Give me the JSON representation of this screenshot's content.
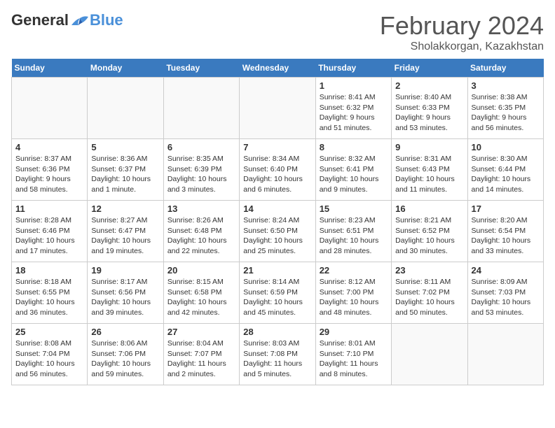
{
  "header": {
    "logo": {
      "general": "General",
      "blue": "Blue"
    },
    "title": "February 2024",
    "location": "Sholakkorgan, Kazakhstan"
  },
  "weekdays": [
    "Sunday",
    "Monday",
    "Tuesday",
    "Wednesday",
    "Thursday",
    "Friday",
    "Saturday"
  ],
  "weeks": [
    [
      {
        "day": "",
        "info": ""
      },
      {
        "day": "",
        "info": ""
      },
      {
        "day": "",
        "info": ""
      },
      {
        "day": "",
        "info": ""
      },
      {
        "day": "1",
        "info": "Sunrise: 8:41 AM\nSunset: 6:32 PM\nDaylight: 9 hours and 51 minutes."
      },
      {
        "day": "2",
        "info": "Sunrise: 8:40 AM\nSunset: 6:33 PM\nDaylight: 9 hours and 53 minutes."
      },
      {
        "day": "3",
        "info": "Sunrise: 8:38 AM\nSunset: 6:35 PM\nDaylight: 9 hours and 56 minutes."
      }
    ],
    [
      {
        "day": "4",
        "info": "Sunrise: 8:37 AM\nSunset: 6:36 PM\nDaylight: 9 hours and 58 minutes."
      },
      {
        "day": "5",
        "info": "Sunrise: 8:36 AM\nSunset: 6:37 PM\nDaylight: 10 hours and 1 minute."
      },
      {
        "day": "6",
        "info": "Sunrise: 8:35 AM\nSunset: 6:39 PM\nDaylight: 10 hours and 3 minutes."
      },
      {
        "day": "7",
        "info": "Sunrise: 8:34 AM\nSunset: 6:40 PM\nDaylight: 10 hours and 6 minutes."
      },
      {
        "day": "8",
        "info": "Sunrise: 8:32 AM\nSunset: 6:41 PM\nDaylight: 10 hours and 9 minutes."
      },
      {
        "day": "9",
        "info": "Sunrise: 8:31 AM\nSunset: 6:43 PM\nDaylight: 10 hours and 11 minutes."
      },
      {
        "day": "10",
        "info": "Sunrise: 8:30 AM\nSunset: 6:44 PM\nDaylight: 10 hours and 14 minutes."
      }
    ],
    [
      {
        "day": "11",
        "info": "Sunrise: 8:28 AM\nSunset: 6:46 PM\nDaylight: 10 hours and 17 minutes."
      },
      {
        "day": "12",
        "info": "Sunrise: 8:27 AM\nSunset: 6:47 PM\nDaylight: 10 hours and 19 minutes."
      },
      {
        "day": "13",
        "info": "Sunrise: 8:26 AM\nSunset: 6:48 PM\nDaylight: 10 hours and 22 minutes."
      },
      {
        "day": "14",
        "info": "Sunrise: 8:24 AM\nSunset: 6:50 PM\nDaylight: 10 hours and 25 minutes."
      },
      {
        "day": "15",
        "info": "Sunrise: 8:23 AM\nSunset: 6:51 PM\nDaylight: 10 hours and 28 minutes."
      },
      {
        "day": "16",
        "info": "Sunrise: 8:21 AM\nSunset: 6:52 PM\nDaylight: 10 hours and 30 minutes."
      },
      {
        "day": "17",
        "info": "Sunrise: 8:20 AM\nSunset: 6:54 PM\nDaylight: 10 hours and 33 minutes."
      }
    ],
    [
      {
        "day": "18",
        "info": "Sunrise: 8:18 AM\nSunset: 6:55 PM\nDaylight: 10 hours and 36 minutes."
      },
      {
        "day": "19",
        "info": "Sunrise: 8:17 AM\nSunset: 6:56 PM\nDaylight: 10 hours and 39 minutes."
      },
      {
        "day": "20",
        "info": "Sunrise: 8:15 AM\nSunset: 6:58 PM\nDaylight: 10 hours and 42 minutes."
      },
      {
        "day": "21",
        "info": "Sunrise: 8:14 AM\nSunset: 6:59 PM\nDaylight: 10 hours and 45 minutes."
      },
      {
        "day": "22",
        "info": "Sunrise: 8:12 AM\nSunset: 7:00 PM\nDaylight: 10 hours and 48 minutes."
      },
      {
        "day": "23",
        "info": "Sunrise: 8:11 AM\nSunset: 7:02 PM\nDaylight: 10 hours and 50 minutes."
      },
      {
        "day": "24",
        "info": "Sunrise: 8:09 AM\nSunset: 7:03 PM\nDaylight: 10 hours and 53 minutes."
      }
    ],
    [
      {
        "day": "25",
        "info": "Sunrise: 8:08 AM\nSunset: 7:04 PM\nDaylight: 10 hours and 56 minutes."
      },
      {
        "day": "26",
        "info": "Sunrise: 8:06 AM\nSunset: 7:06 PM\nDaylight: 10 hours and 59 minutes."
      },
      {
        "day": "27",
        "info": "Sunrise: 8:04 AM\nSunset: 7:07 PM\nDaylight: 11 hours and 2 minutes."
      },
      {
        "day": "28",
        "info": "Sunrise: 8:03 AM\nSunset: 7:08 PM\nDaylight: 11 hours and 5 minutes."
      },
      {
        "day": "29",
        "info": "Sunrise: 8:01 AM\nSunset: 7:10 PM\nDaylight: 11 hours and 8 minutes."
      },
      {
        "day": "",
        "info": ""
      },
      {
        "day": "",
        "info": ""
      }
    ]
  ]
}
